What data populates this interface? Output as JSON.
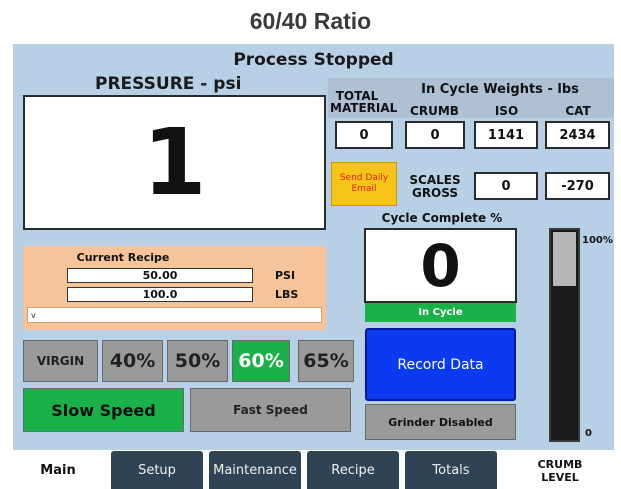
{
  "page_title": "60/40 Ratio",
  "status": "Process Stopped",
  "pressure": {
    "label": "PRESSURE - psi",
    "value": "1"
  },
  "weights": {
    "title": "In Cycle Weights - lbs",
    "total_material_label": "TOTAL MATERIAL",
    "total_material_value": "0",
    "columns": [
      {
        "label": "CRUMB",
        "value": "0"
      },
      {
        "label": "ISO",
        "value": "1141"
      },
      {
        "label": "CAT",
        "value": "2434"
      }
    ],
    "scales_label": "SCALES GROSS",
    "scales_values": [
      "0",
      "-270"
    ]
  },
  "send_email_button": "Send Daily Email",
  "cycle": {
    "title": "Cycle Complete %",
    "value": "0",
    "status": "In Cycle"
  },
  "record_button": "Record Data",
  "grinder_status": "Grinder Disabled",
  "recipe": {
    "title": "Current Recipe",
    "psi_value": "50.00",
    "psi_unit": "PSI",
    "lbs_value": "100.0",
    "lbs_unit": "LBS",
    "name": "v"
  },
  "ratio_buttons": [
    {
      "label": "VIRGIN",
      "active": false
    },
    {
      "label": "40%",
      "active": false
    },
    {
      "label": "50%",
      "active": false
    },
    {
      "label": "60%",
      "active": true
    },
    {
      "label": "65%",
      "active": false
    }
  ],
  "speed": {
    "slow": "Slow Speed",
    "fast": "Fast Speed",
    "active": "slow"
  },
  "crumb_gauge": {
    "top_label": "100%",
    "bottom_label": "0",
    "title": "CRUMB LEVEL",
    "level_fraction": 0.74
  },
  "tabs": [
    {
      "label": "Main",
      "active": true
    },
    {
      "label": "Setup",
      "active": false
    },
    {
      "label": "Maintenance",
      "active": false
    },
    {
      "label": "Recipe",
      "active": false
    },
    {
      "label": "Totals",
      "active": false
    }
  ],
  "colors": {
    "panel": "#b8d0e6",
    "active_green": "#1ab14a",
    "record_blue": "#0a3bf0",
    "email_yellow": "#f6c419",
    "recipe_orange": "#f7c49a"
  }
}
